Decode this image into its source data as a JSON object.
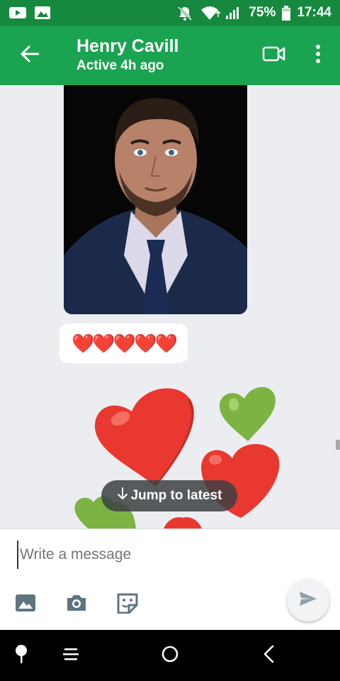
{
  "status_bar": {
    "icons_left": [
      "youtube-icon",
      "gallery-icon"
    ],
    "icons_right": [
      "mute-icon",
      "wifi-icon",
      "signal-icon",
      "battery-icon"
    ],
    "battery": "75%",
    "time": "17:44"
  },
  "header": {
    "contact_name": "Henry Cavill",
    "contact_status": "Active 4h ago",
    "icons": [
      "back-arrow-icon",
      "video-call-icon",
      "more-vert-icon"
    ]
  },
  "messages": [
    {
      "type": "image",
      "alt": "photo"
    },
    {
      "type": "text",
      "text": "❤️❤️❤️❤️❤️"
    },
    {
      "type": "sticker",
      "icon": "hearts-sticker"
    }
  ],
  "jump_button": {
    "label": "Jump to latest"
  },
  "composer": {
    "placeholder": "Write a message",
    "value": "",
    "tools": [
      "image-icon",
      "camera-icon",
      "sticker-icon"
    ],
    "send_icon": "send-icon"
  },
  "colors": {
    "status_bar": "#16893f",
    "app_bar": "#1aa351",
    "background": "#ebedf0",
    "heart_red": "#e8382f",
    "heart_green": "#7cb342"
  }
}
